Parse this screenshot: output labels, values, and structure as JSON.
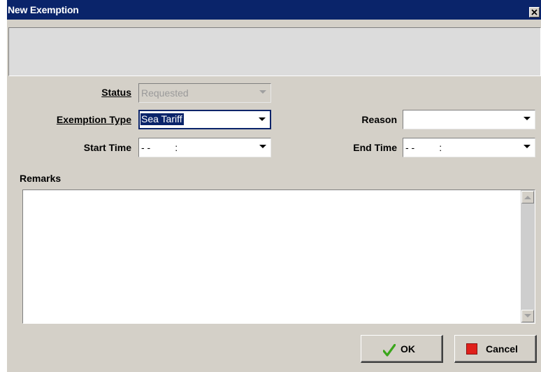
{
  "window": {
    "title": "New Exemption",
    "close_icon": "close-icon"
  },
  "form": {
    "status": {
      "label": "Status",
      "value": "Requested",
      "disabled": true
    },
    "exemption_type": {
      "label": "Exemption Type",
      "value": "Sea Tariff",
      "selected": true
    },
    "reason": {
      "label": "Reason",
      "value": ""
    },
    "start_time": {
      "label": "Start Time",
      "value": "- -         :"
    },
    "end_time": {
      "label": "End Time",
      "value": "- -         :"
    },
    "remarks": {
      "label": "Remarks",
      "value": ""
    }
  },
  "buttons": {
    "ok": {
      "label": "OK",
      "icon": "checkmark-icon"
    },
    "cancel": {
      "label": "Cancel",
      "icon": "red-square-stop-icon"
    }
  },
  "colors": {
    "titlebar": "#0a246a",
    "dialog_bg": "#d4d0c8",
    "ok_check": "#3aa61b",
    "cancel_square": "#e0201b"
  }
}
